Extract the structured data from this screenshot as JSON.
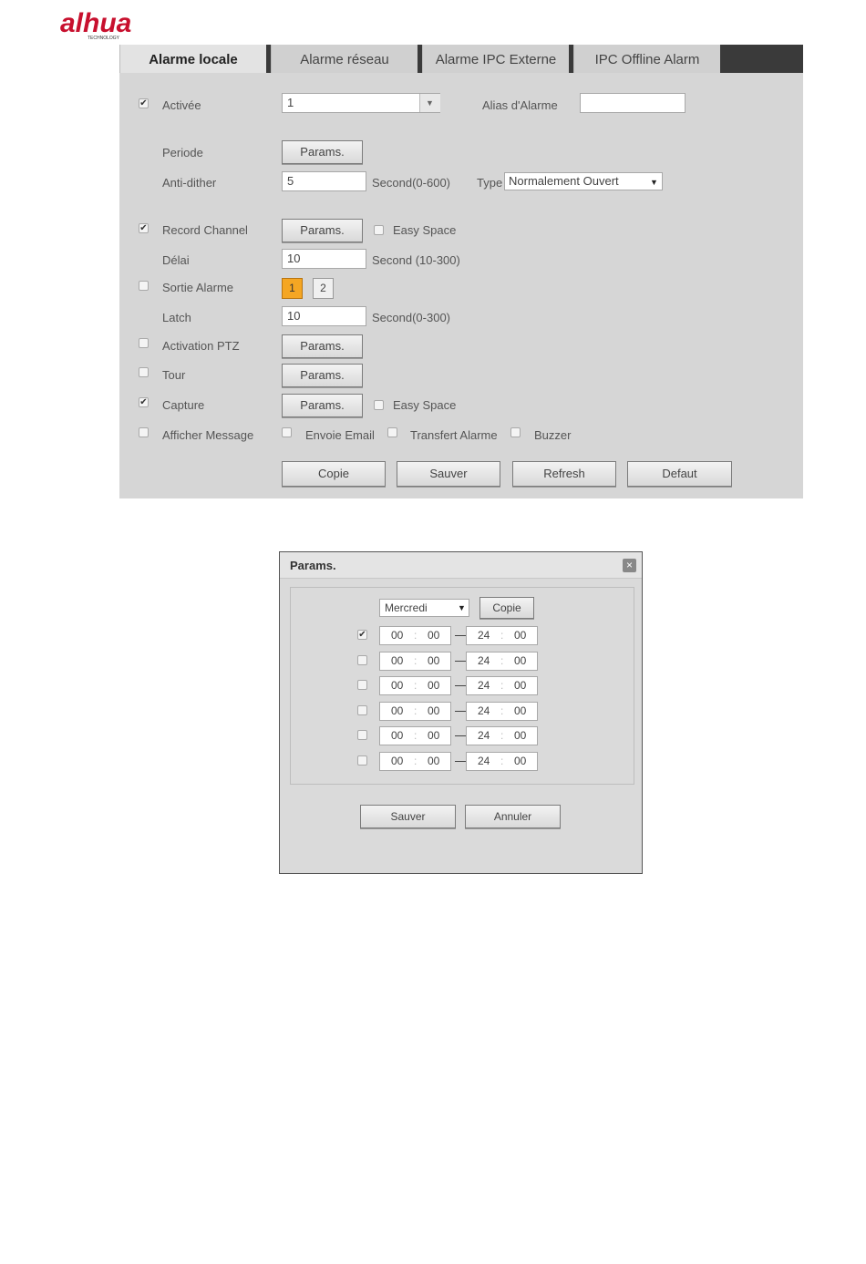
{
  "logo": {
    "brand": "alhua",
    "tagline": "TECHNOLOGY",
    "brand_color": "#c8102e"
  },
  "tabs": [
    {
      "label": "Alarme locale",
      "active": true
    },
    {
      "label": "Alarme réseau",
      "active": false
    },
    {
      "label": "Alarme IPC Externe",
      "active": false
    },
    {
      "label": "IPC Offline Alarm",
      "active": false
    }
  ],
  "form": {
    "activee": {
      "label": "Activée",
      "checked": true,
      "select_value": "1"
    },
    "alias": {
      "label": "Alias d'Alarme",
      "value": ""
    },
    "periode": {
      "label": "Periode",
      "button": "Params."
    },
    "antidither": {
      "label": "Anti-dither",
      "value": "5",
      "unit": "Second(0-600)"
    },
    "type": {
      "label": "Type",
      "value": "Normalement Ouvert"
    },
    "record_channel": {
      "label": "Record Channel",
      "checked": true,
      "button": "Params.",
      "easy_space": "Easy Space"
    },
    "delai": {
      "label": "Délai",
      "value": "10",
      "unit": "Second (10-300)"
    },
    "sortie_alarme": {
      "label": "Sortie Alarme",
      "checked": false,
      "outputs": [
        "1",
        "2"
      ]
    },
    "latch": {
      "label": "Latch",
      "value": "10",
      "unit": "Second(0-300)"
    },
    "activation_ptz": {
      "label": "Activation PTZ",
      "checked": false,
      "button": "Params."
    },
    "tour": {
      "label": "Tour",
      "checked": false,
      "button": "Params."
    },
    "capture": {
      "label": "Capture",
      "checked": true,
      "button": "Params.",
      "easy_space": "Easy Space"
    },
    "afficher_message": {
      "label": "Afficher Message",
      "checked": false
    },
    "envoie_email": {
      "label": "Envoie Email",
      "checked": false
    },
    "transfert_alarme": {
      "label": "Transfert Alarme",
      "checked": false
    },
    "buzzer": {
      "label": "Buzzer",
      "checked": false
    }
  },
  "actions": {
    "copie": "Copie",
    "sauver": "Sauver",
    "refresh": "Refresh",
    "defaut": "Defaut"
  },
  "dialog": {
    "title": "Params.",
    "close_icon": "×",
    "day": "Mercredi",
    "copy": "Copie",
    "periods": [
      {
        "checked": true,
        "start_h": "00",
        "start_m": "00",
        "end_h": "24",
        "end_m": "00"
      },
      {
        "checked": false,
        "start_h": "00",
        "start_m": "00",
        "end_h": "24",
        "end_m": "00"
      },
      {
        "checked": false,
        "start_h": "00",
        "start_m": "00",
        "end_h": "24",
        "end_m": "00"
      },
      {
        "checked": false,
        "start_h": "00",
        "start_m": "00",
        "end_h": "24",
        "end_m": "00"
      },
      {
        "checked": false,
        "start_h": "00",
        "start_m": "00",
        "end_h": "24",
        "end_m": "00"
      },
      {
        "checked": false,
        "start_h": "00",
        "start_m": "00",
        "end_h": "24",
        "end_m": "00"
      }
    ],
    "save": "Sauver",
    "cancel": "Annuler"
  }
}
